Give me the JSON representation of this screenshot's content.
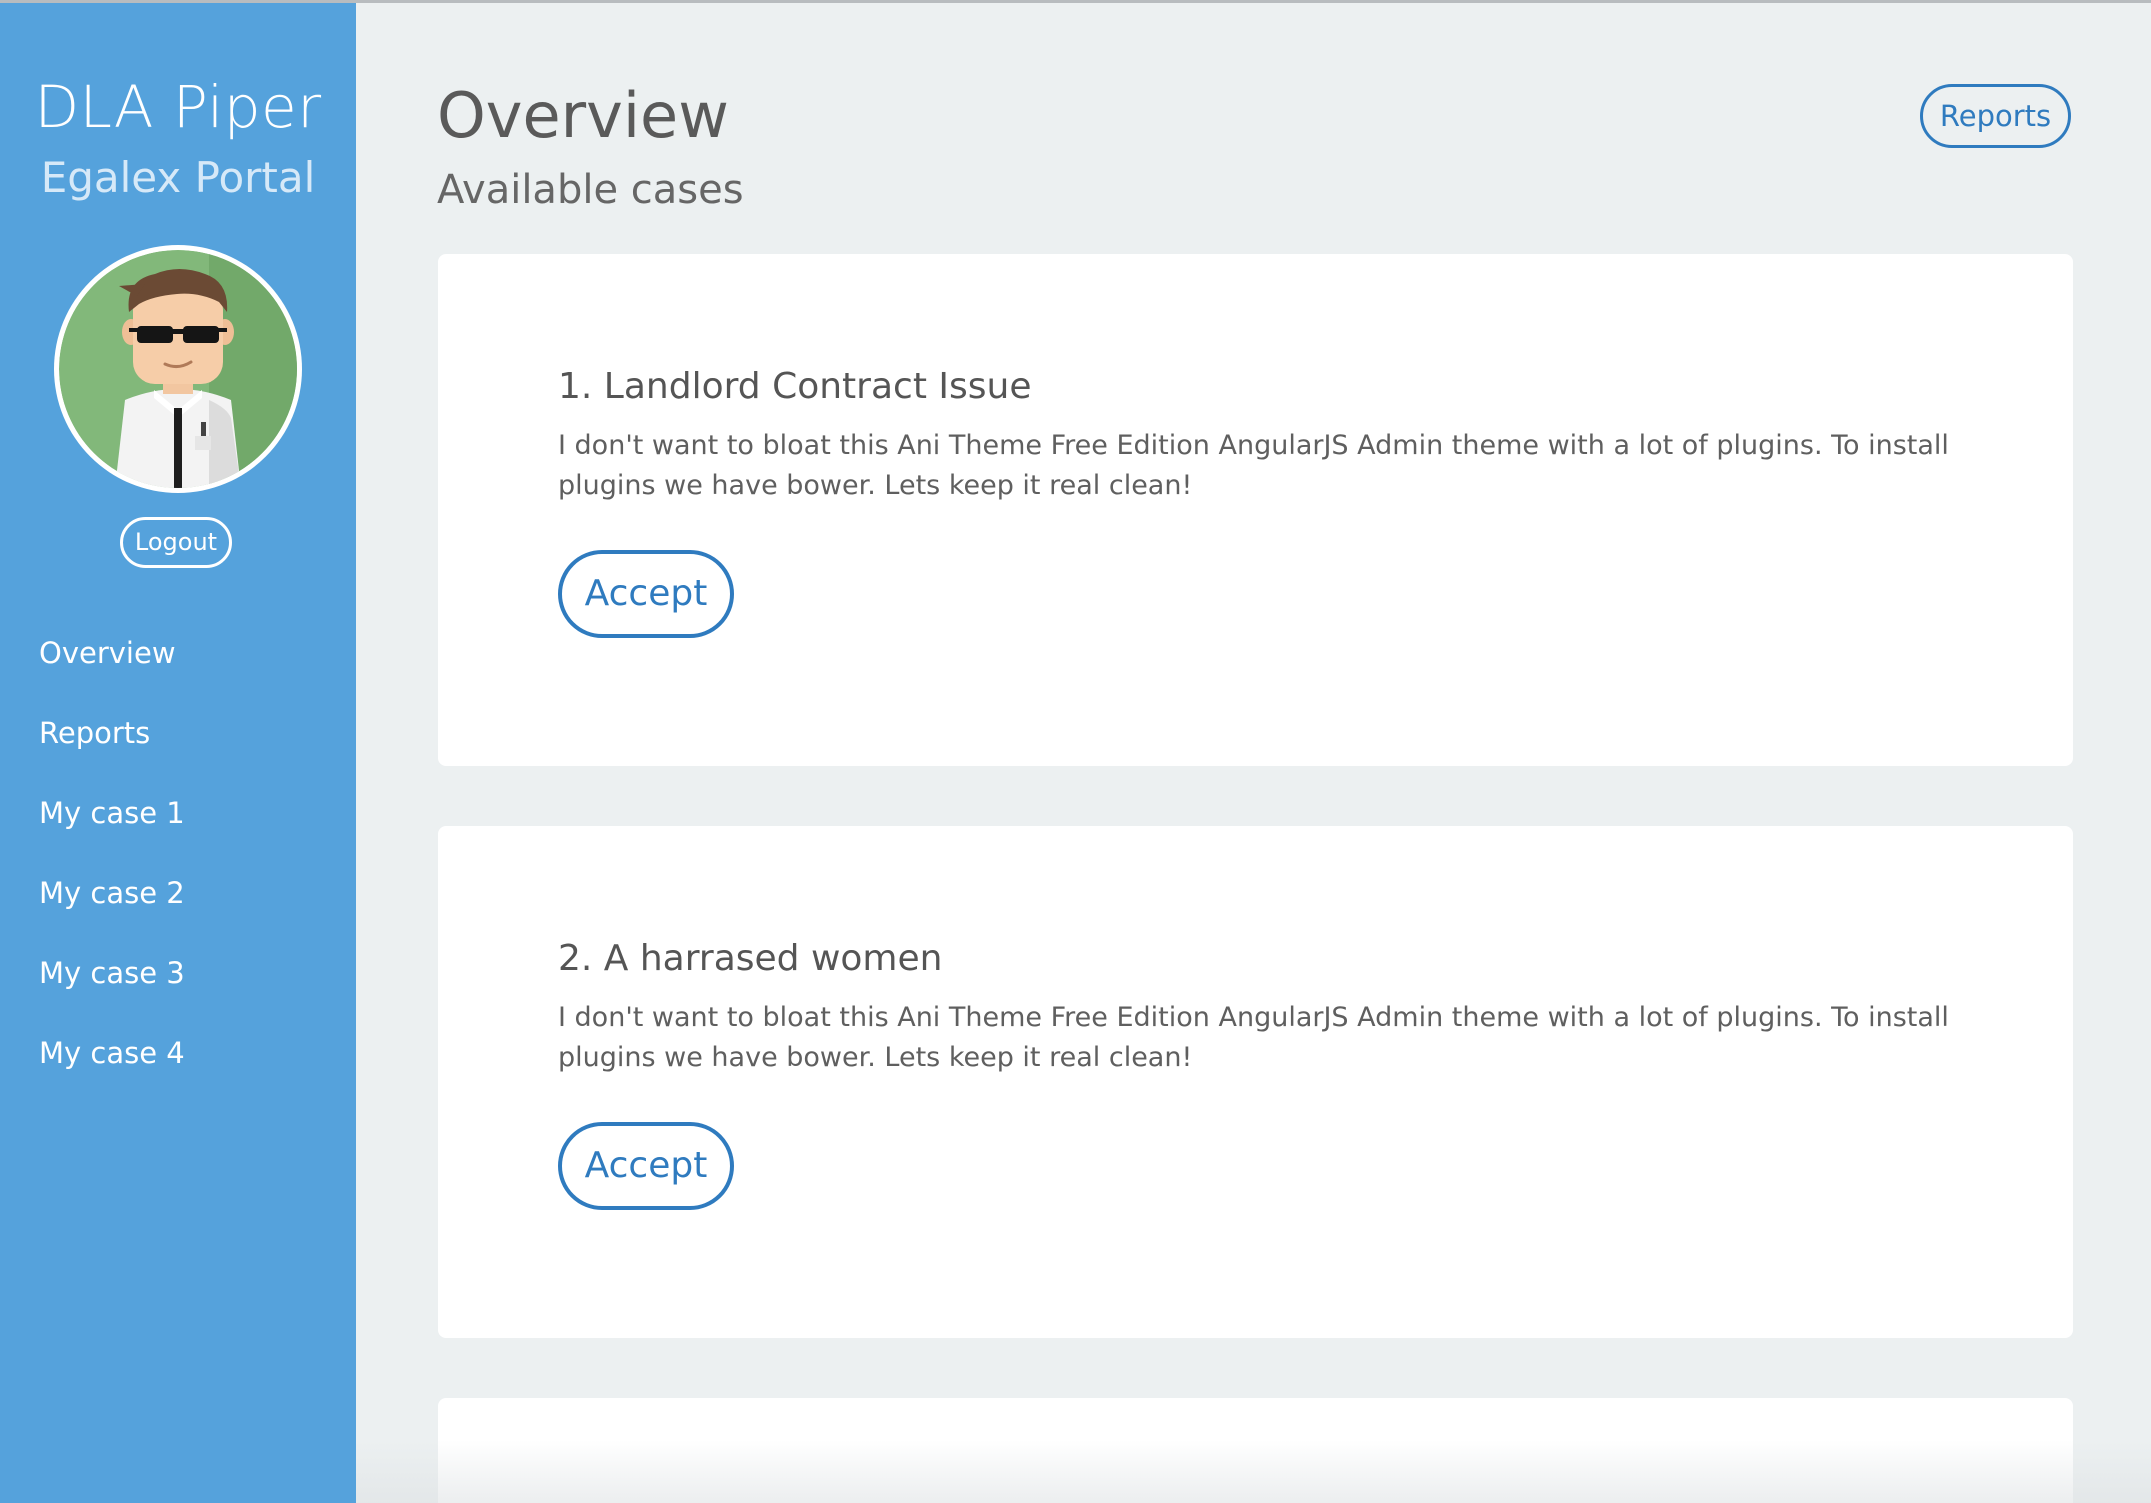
{
  "sidebar": {
    "brand_title": "DLA Piper",
    "brand_subtitle": "Egalex Portal",
    "logout_label": "Logout",
    "nav_items": [
      {
        "label": "Overview"
      },
      {
        "label": "Reports"
      },
      {
        "label": "My case 1"
      },
      {
        "label": "My case 2"
      },
      {
        "label": "My case 3"
      },
      {
        "label": "My case 4"
      }
    ]
  },
  "header": {
    "title": "Overview",
    "subtitle": "Available cases",
    "reports_label": "Reports"
  },
  "cases": [
    {
      "title": "1. Landlord Contract Issue",
      "description": "I don't want to bloat this Ani Theme Free Edition AngularJS Admin theme with a lot of plugins. To install plugins we have bower. Lets keep it real clean!",
      "accept_label": "Accept"
    },
    {
      "title": "2. A harrased women",
      "description": "I don't want to bloat this Ani Theme Free Edition AngularJS Admin theme with a lot of plugins. To install plugins we have bower. Lets keep it real clean!",
      "accept_label": "Accept"
    }
  ],
  "colors": {
    "sidebar_bg": "#55a2dc",
    "page_bg": "#ecf0f1",
    "accent": "#2f7bbf",
    "card_bg": "#ffffff"
  },
  "icons": {
    "avatar": "user-avatar-illustration"
  }
}
